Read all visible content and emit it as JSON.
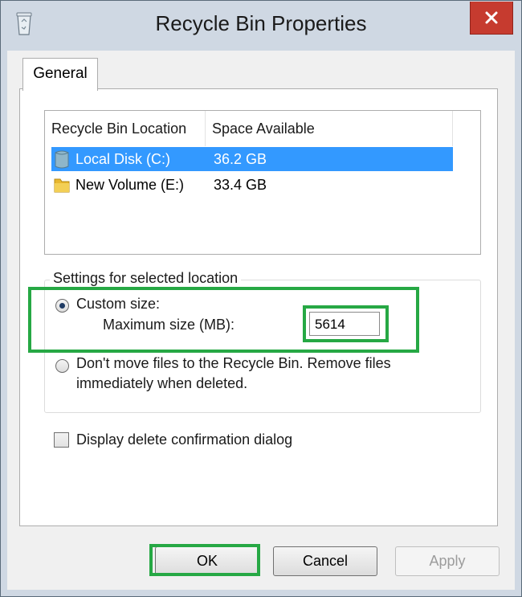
{
  "window": {
    "title": "Recycle Bin Properties"
  },
  "tabs": [
    {
      "label": "General"
    }
  ],
  "list": {
    "columns": [
      "Recycle Bin Location",
      "Space Available"
    ],
    "rows": [
      {
        "name": "Local Disk (C:)",
        "space": "36.2 GB",
        "selected": true,
        "icon": "drive-icon"
      },
      {
        "name": "New Volume (E:)",
        "space": "33.4 GB",
        "selected": false,
        "icon": "folder-icon"
      }
    ]
  },
  "settings": {
    "legend": "Settings for selected location",
    "custom_size_label": "Custom size:",
    "max_size_label": "Maximum size (MB):",
    "max_size_value": "5614",
    "dont_move_line1": "Don't move files to the Recycle Bin. Remove files",
    "dont_move_line2": "immediately when deleted.",
    "selected_option": "custom"
  },
  "confirm": {
    "label": "Display delete confirmation dialog",
    "checked": false
  },
  "buttons": {
    "ok": "OK",
    "cancel": "Cancel",
    "apply": "Apply"
  },
  "colors": {
    "highlight": "#26a844",
    "selection": "#3399ff",
    "close": "#c63b2f"
  }
}
